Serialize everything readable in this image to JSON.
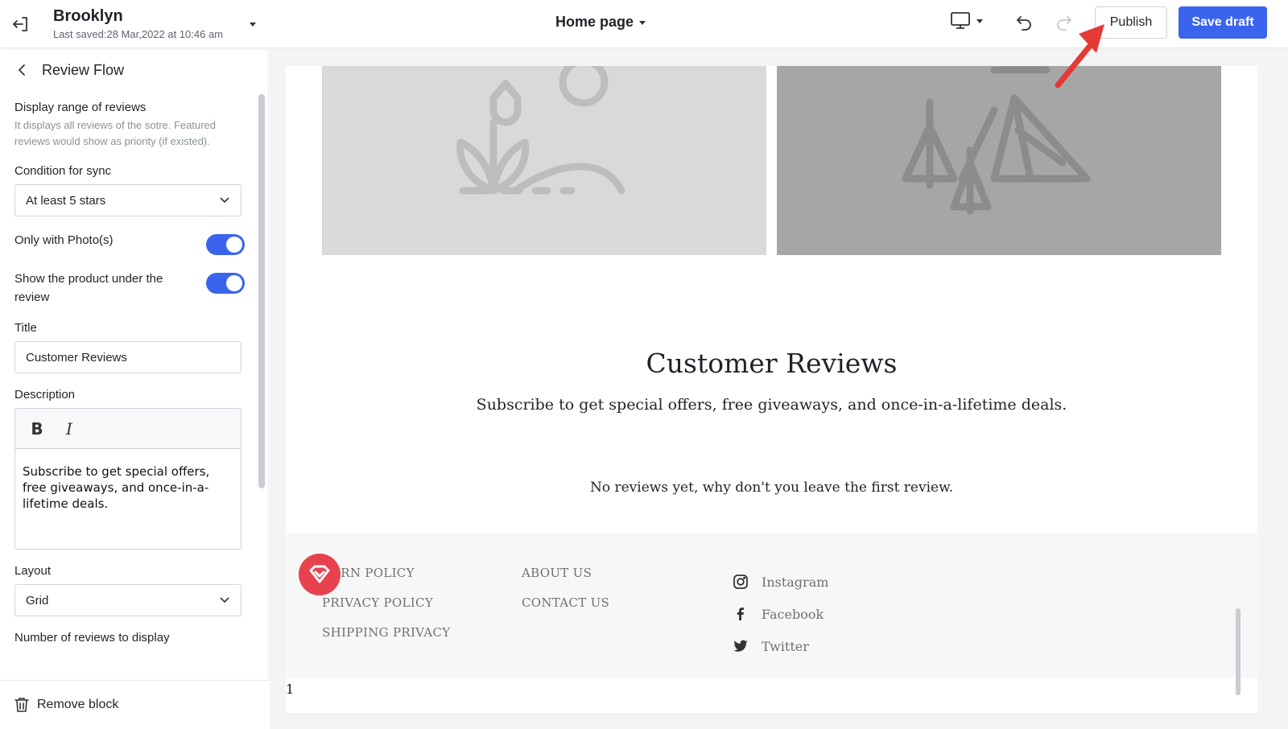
{
  "topbar": {
    "store_name": "Brooklyn",
    "last_saved": "Last saved:28 Mar,2022 at 10:46 am",
    "page_select": "Home page",
    "publish_label": "Publish",
    "save_draft_label": "Save draft"
  },
  "sidebar": {
    "title": "Review Flow",
    "display_range_label": "Display range of reviews",
    "display_range_hint": "It displays all reviews of the sotre. Featured reviews would show as priority (if existed).",
    "condition_label": "Condition for sync",
    "condition_value": "At least 5 stars",
    "only_photos_label": "Only with Photo(s)",
    "show_product_label": "Show the product under the review",
    "title_label": "Title",
    "title_value": "Customer Reviews",
    "description_label": "Description",
    "bold_label": "B",
    "italic_label": "I",
    "description_value": "Subscribe to get special offers, free giveaways, and once-in-a-lifetime deals.",
    "layout_label": "Layout",
    "layout_value": "Grid",
    "number_label": "Number of reviews to display",
    "remove_block_label": "Remove block"
  },
  "preview": {
    "reviews_title": "Customer Reviews",
    "reviews_description": "Subscribe to get special offers, free giveaways, and once-in-a-lifetime deals.",
    "no_reviews": "No reviews yet, why don't you leave the first review.",
    "footer_col1": [
      "TURN POLICY",
      "PRIVACY POLICY",
      "SHIPPING PRIVACY"
    ],
    "footer_col2": [
      "ABOUT US",
      "CONTACT US"
    ],
    "social": [
      "Instagram",
      "Facebook",
      "Twitter"
    ],
    "page_number": "1"
  },
  "colors": {
    "accent": "#3a64ee",
    "badge": "#e8424f",
    "arrow": "#e53935"
  }
}
